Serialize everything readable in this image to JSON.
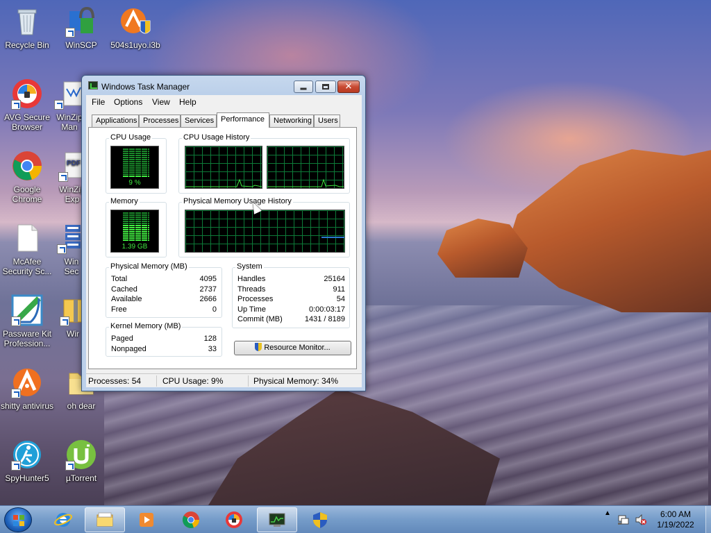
{
  "desktop": {
    "icons": [
      {
        "label": "Recycle Bin",
        "icon": "recycle-bin-icon"
      },
      {
        "label": "WinSCP",
        "icon": "winscp-icon"
      },
      {
        "label": "504s1uyo.i3b",
        "icon": "avast-file-icon"
      },
      {
        "label": "AVG Secure Browser",
        "icon": "avg-browser-icon"
      },
      {
        "label": "WinZip Man",
        "icon": "winzip-icon"
      },
      {
        "label": "Google Chrome",
        "icon": "chrome-icon"
      },
      {
        "label": "WinZip Exp",
        "icon": "winzip-pdf-icon"
      },
      {
        "label": "McAfee Security Sc...",
        "icon": "document-icon"
      },
      {
        "label": "Win Sec",
        "icon": "server-icon"
      },
      {
        "label": "Passware Kit Profession...",
        "icon": "passware-icon"
      },
      {
        "label": "Wir",
        "icon": "folder-zip-icon"
      },
      {
        "label": "shitty antivirus",
        "icon": "avast-icon"
      },
      {
        "label": "oh dear",
        "icon": "folder-icon"
      },
      {
        "label": "SpyHunter5",
        "icon": "spyhunter-icon"
      },
      {
        "label": "µTorrent",
        "icon": "utorrent-icon"
      }
    ]
  },
  "window": {
    "title": "Windows Task Manager",
    "menu": [
      "File",
      "Options",
      "View",
      "Help"
    ],
    "tabs": [
      "Applications",
      "Processes",
      "Services",
      "Performance",
      "Networking",
      "Users"
    ],
    "active_tab": "Performance",
    "cpu_usage": {
      "label": "CPU Usage",
      "value": "9 %"
    },
    "cpu_history": {
      "label": "CPU Usage History"
    },
    "memory": {
      "label": "Memory",
      "value": "1.39 GB"
    },
    "memory_history": {
      "label": "Physical Memory Usage History"
    },
    "physical_memory": {
      "label": "Physical Memory (MB)",
      "rows": [
        {
          "k": "Total",
          "v": "4095"
        },
        {
          "k": "Cached",
          "v": "2737"
        },
        {
          "k": "Available",
          "v": "2666"
        },
        {
          "k": "Free",
          "v": "0"
        }
      ]
    },
    "kernel_memory": {
      "label": "Kernel Memory (MB)",
      "rows": [
        {
          "k": "Paged",
          "v": "128"
        },
        {
          "k": "Nonpaged",
          "v": "33"
        }
      ]
    },
    "system": {
      "label": "System",
      "rows": [
        {
          "k": "Handles",
          "v": "25164"
        },
        {
          "k": "Threads",
          "v": "911"
        },
        {
          "k": "Processes",
          "v": "54"
        },
        {
          "k": "Up Time",
          "v": "0:00:03:17"
        },
        {
          "k": "Commit (MB)",
          "v": "1431 / 8189"
        }
      ]
    },
    "resource_monitor_label": "Resource Monitor...",
    "status": {
      "processes": "Processes: 54",
      "cpu": "CPU Usage: 9%",
      "memory": "Physical Memory: 34%"
    }
  },
  "taskbar": {
    "items": [
      "start-button",
      "internet-explorer-icon",
      "windows-explorer-icon",
      "media-player-icon",
      "chrome-icon",
      "avg-browser-icon",
      "task-manager-icon"
    ],
    "tray": [
      "show-hidden-icons",
      "network-icon",
      "volume-muted-icon",
      "action-center-icon"
    ],
    "clock_time": "6:00 AM",
    "clock_date": "1/19/2022"
  },
  "colors": {
    "graph_green": "#3fe63f",
    "grid_green": "#0d7a38",
    "memory_line": "#2a7ad0"
  }
}
